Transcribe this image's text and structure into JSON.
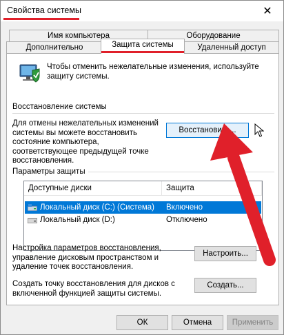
{
  "window": {
    "title": "Свойства системы",
    "close": "✕"
  },
  "tabs": {
    "row1": [
      "Имя компьютера",
      "Оборудование"
    ],
    "row2": [
      "Дополнительно",
      "Защита системы",
      "Удаленный доступ"
    ]
  },
  "intro": "Чтобы отменить нежелательные изменения, используйте защиту системы.",
  "restore": {
    "section_title": "Восстановление системы",
    "description": "Для отмены нежелательных изменений системы вы можете восстановить состояние компьютера, соответствующее предыдущей точке восстановления.",
    "button": "Восстановить..."
  },
  "protection": {
    "section_title": "Параметры защиты",
    "columns": [
      "Доступные диски",
      "Защита"
    ],
    "disks": [
      {
        "name": "Локальный диск (C:) (Система)",
        "state": "Включено",
        "selected": true
      },
      {
        "name": "Локальный диск (D:)",
        "state": "Отключено",
        "selected": false
      }
    ],
    "configure_text": "Настройка параметров восстановления, управление дисковым пространством и удаление точек восстановления.",
    "configure_button": "Настроить...",
    "create_text": "Создать точку восстановления для дисков с включенной функцией защиты системы.",
    "create_button": "Создать..."
  },
  "footer": {
    "ok": "ОК",
    "cancel": "Отмена",
    "apply": "Применить"
  },
  "colors": {
    "accent_red": "#e0202a",
    "selection_blue": "#0078d7"
  }
}
